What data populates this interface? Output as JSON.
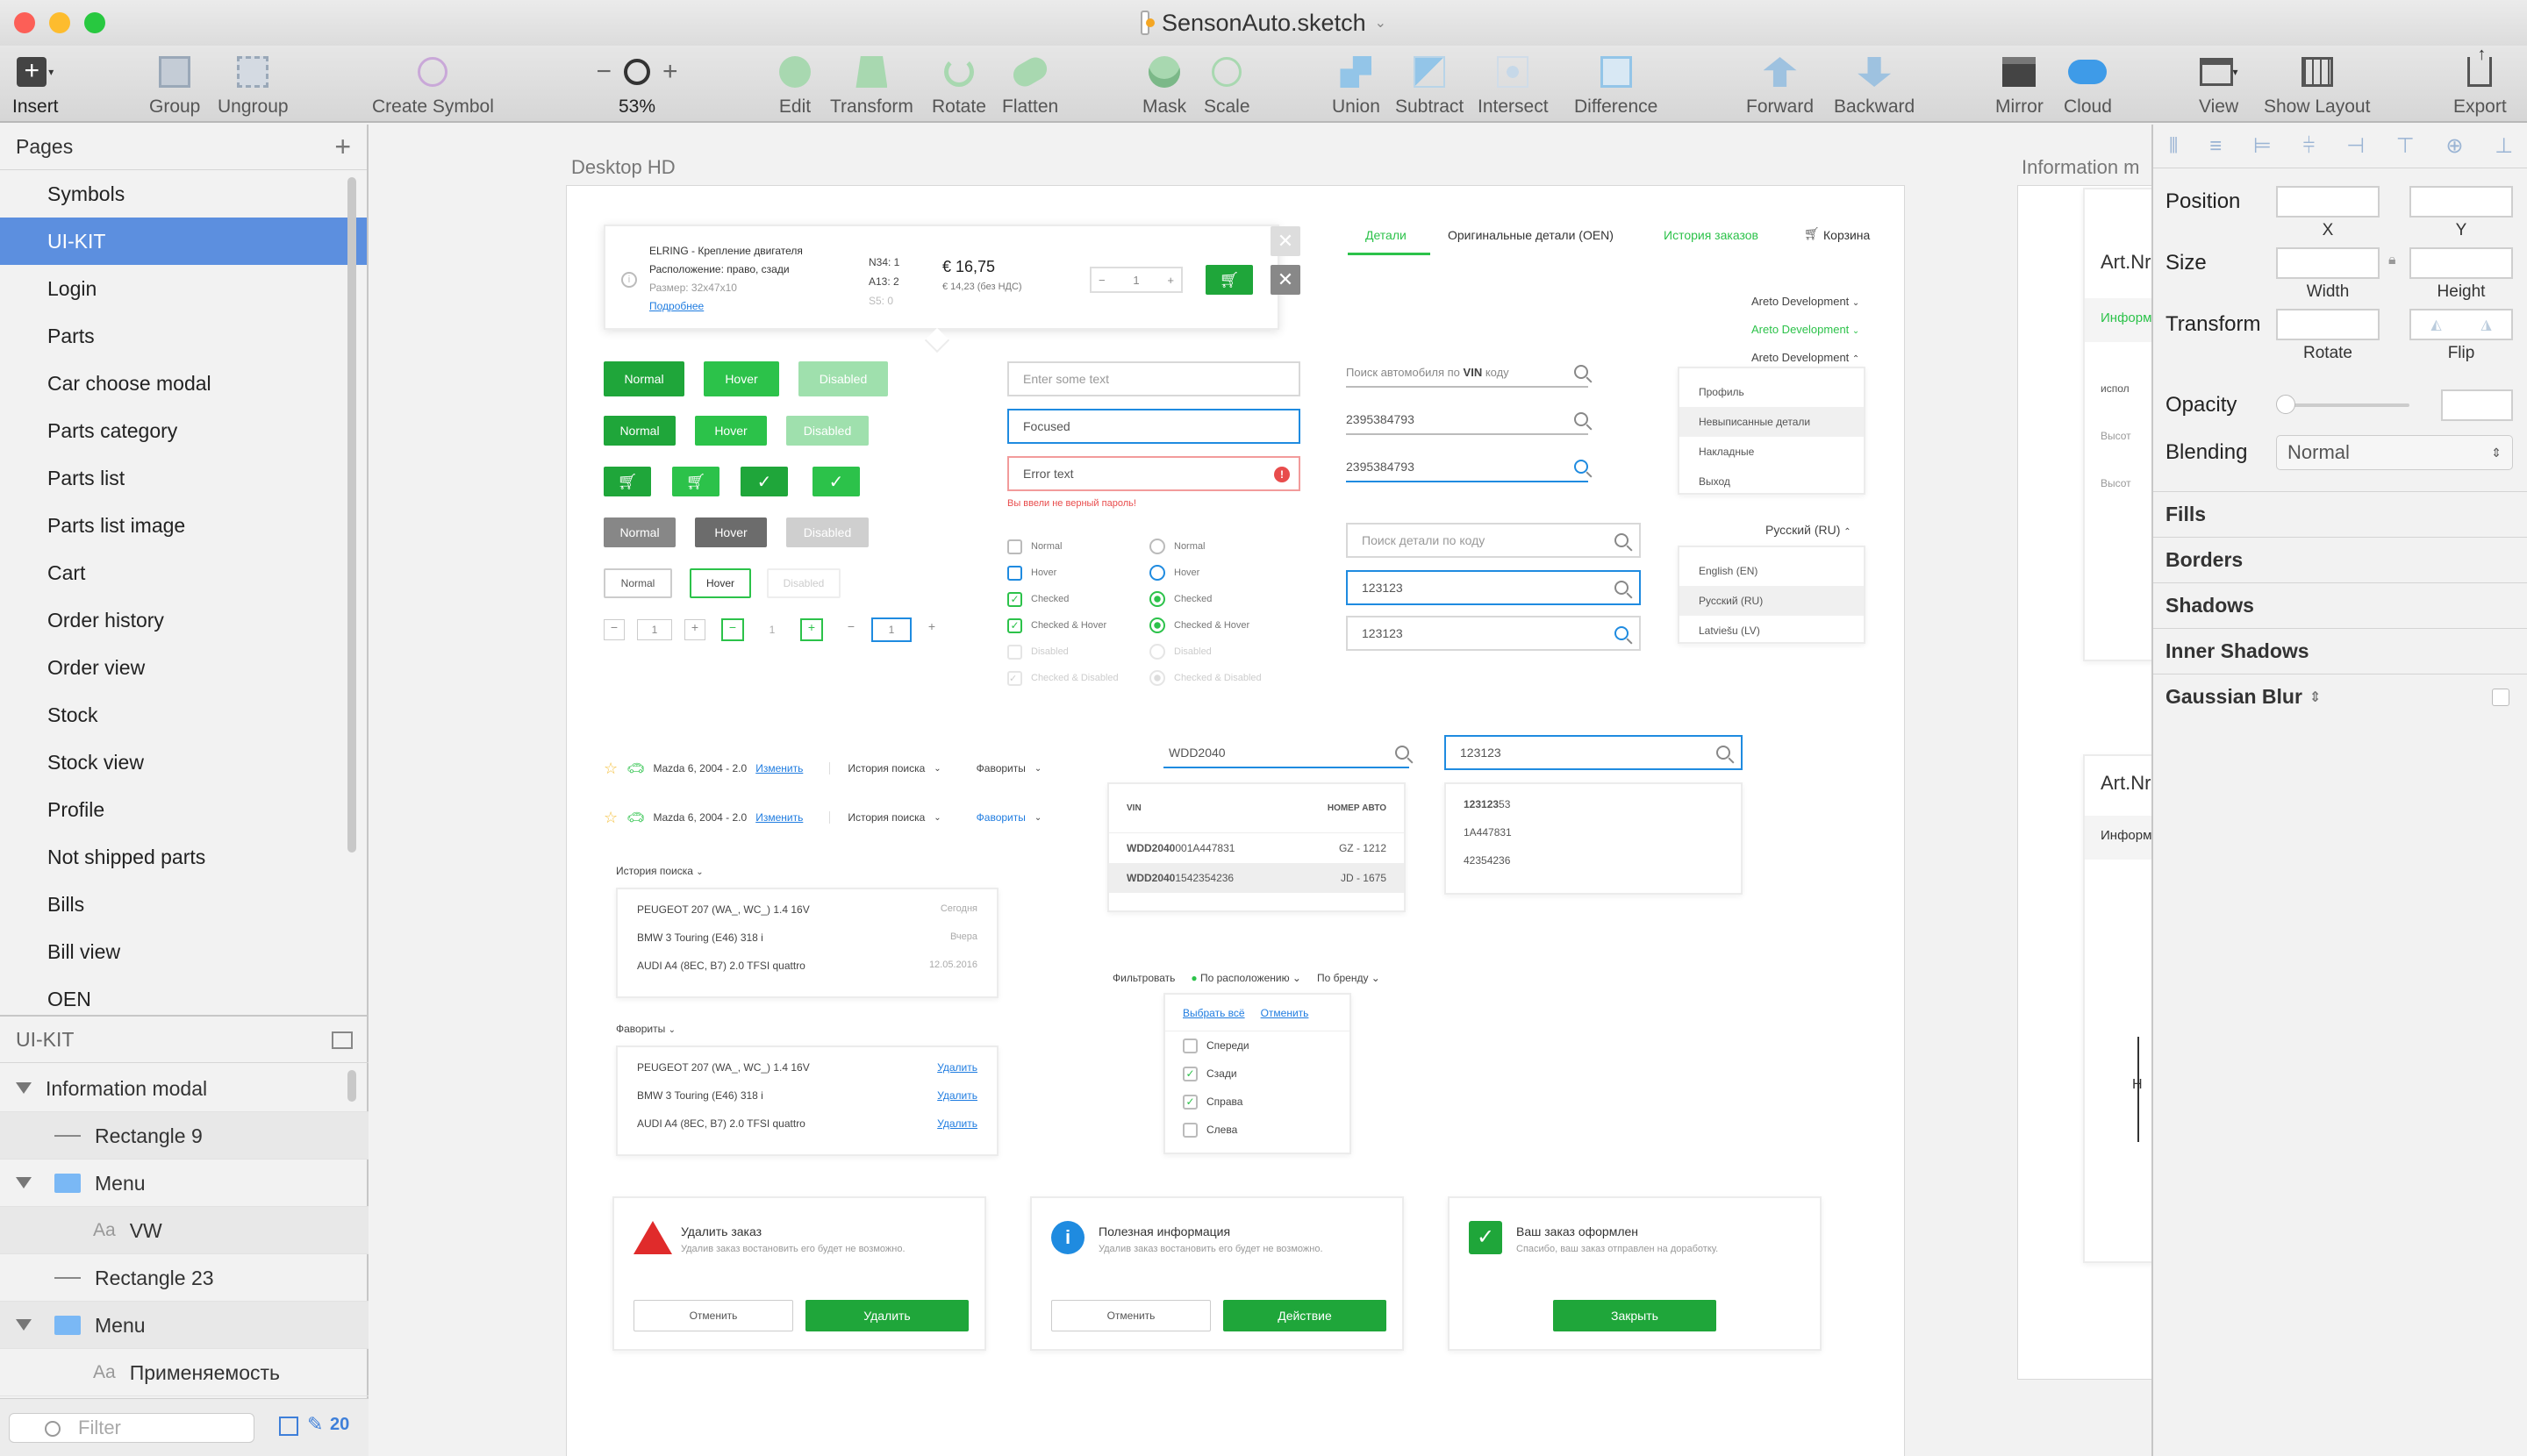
{
  "window": {
    "title": "SensonAuto.sketch"
  },
  "toolbar": {
    "insert": "Insert",
    "group": "Group",
    "ungroup": "Ungroup",
    "create_symbol": "Create Symbol",
    "zoom": "53%",
    "edit": "Edit",
    "transform": "Transform",
    "rotate": "Rotate",
    "flatten": "Flatten",
    "mask": "Mask",
    "scale": "Scale",
    "union": "Union",
    "subtract": "Subtract",
    "intersect": "Intersect",
    "difference": "Difference",
    "forward": "Forward",
    "backward": "Backward",
    "mirror": "Mirror",
    "cloud": "Cloud",
    "view": "View",
    "show_layout": "Show Layout",
    "export": "Export"
  },
  "pages": {
    "header": "Pages",
    "items": [
      "Symbols",
      "UI-KIT",
      "Login",
      "Parts",
      "Car choose modal",
      "Parts category",
      "Parts list",
      "Parts list image",
      "Cart",
      "Order history",
      "Order view",
      "Stock",
      "Stock view",
      "Profile",
      "Not shipped parts",
      "Bills",
      "Bill view",
      "OEN"
    ],
    "selected": "UI-KIT"
  },
  "layers": {
    "header": "UI-KIT",
    "items": [
      {
        "kind": "group-open",
        "label": "Information modal",
        "level": 0
      },
      {
        "kind": "shape",
        "label": "Rectangle 9",
        "level": 1
      },
      {
        "kind": "folder",
        "label": "Menu",
        "level": 1
      },
      {
        "kind": "text",
        "label": "VW",
        "level": 2
      },
      {
        "kind": "shape",
        "label": "Rectangle 23",
        "level": 1
      },
      {
        "kind": "folder",
        "label": "Menu",
        "level": 1
      },
      {
        "kind": "text",
        "label": "Применяемость",
        "level": 2
      }
    ],
    "filter_placeholder": "Filter",
    "count": "20"
  },
  "canvas": {
    "artboard1_label": "Desktop HD",
    "artboard2_label": "Information m",
    "product": {
      "name": "ELRING - Крепление двигателя",
      "location": "Расположение: право, сзади",
      "size": "Размер: 32x47x10",
      "more": "Подробнее",
      "n34": "N34: 1",
      "a13": "A13: 2",
      "s5": "S5: 0",
      "price": "€ 16,75",
      "price_net": "€ 14,23 (без НДС)",
      "qty": "1"
    },
    "tabs": {
      "details": "Детали",
      "oen": "Оригинальные детали (OEN)",
      "history": "История заказов",
      "cart": "Корзина"
    },
    "buttons": {
      "normal": "Normal",
      "hover": "Hover",
      "disabled": "Disabled"
    },
    "steppers": [
      "1",
      "1",
      "1"
    ],
    "inputs": {
      "placeholder": "Enter some text",
      "focused": "Focused",
      "error": "Error text",
      "error_msg": "Вы ввели не верный пароль!"
    },
    "checks": [
      "Normal",
      "Hover",
      "Checked",
      "Checked & Hover",
      "Disabled",
      "Checked & Disabled"
    ],
    "vin_search": {
      "placeholder_pre": "Поиск автомобиля по ",
      "placeholder_bold": "VIN",
      "placeholder_post": " коду",
      "value1": "2395384793",
      "value2": "2395384793"
    },
    "code_search": {
      "placeholder": "Поиск детали по коду",
      "value1": "123123",
      "value2": "123123"
    },
    "account": {
      "name1": "Areto Development",
      "name2": "Areto Development",
      "name3": "Areto Development",
      "menu": [
        "Профиль",
        "Невыписанные детали",
        "Накладные",
        "Выход"
      ]
    },
    "language": {
      "current": "Русский (RU)",
      "menu": [
        "English (EN)",
        "Русский (RU)",
        "Latviešu (LV)"
      ]
    },
    "car_bar": {
      "car": "Mazda 6, 2004 - 2.0",
      "change": "Изменить",
      "history": "История поиска",
      "favorites": "Фавориты"
    },
    "vin_drop": {
      "query": "WDD2040",
      "col1": "VIN",
      "col2": "НОМЕР АВТО",
      "rows": [
        {
          "bold": "WDD2040",
          "rest": "001A447831",
          "plate": "GZ - 1212"
        },
        {
          "bold": "WDD2040",
          "rest": "1542354236",
          "plate": "JD - 1675"
        }
      ]
    },
    "code_drop": {
      "query": "123123",
      "results": [
        {
          "bold": "123123",
          "rest": "53"
        },
        {
          "bold": "",
          "rest": "1A447831"
        },
        {
          "bold": "",
          "rest": "42354236"
        }
      ]
    },
    "history_panel": {
      "title": "История поиска",
      "rows": [
        {
          "car": "PEUGEOT 207 (WA_, WC_) 1.4 16V",
          "when": "Сегодня"
        },
        {
          "car": "BMW 3 Touring (E46) 318 i",
          "when": "Вчера"
        },
        {
          "car": "AUDI A4 (8EC, B7) 2.0 TFSI quattro",
          "when": "12.05.2016"
        }
      ]
    },
    "fav_panel": {
      "title": "Фавориты",
      "rows": [
        {
          "car": "PEUGEOT 207 (WA_, WC_) 1.4 16V",
          "action": "Удалить"
        },
        {
          "car": "BMW 3 Touring (E46) 318 i",
          "action": "Удалить"
        },
        {
          "car": "AUDI A4 (8EC, B7) 2.0 TFSI quattro",
          "action": "Удалить"
        }
      ]
    },
    "filter": {
      "label": "Фильтровать",
      "by_location": "По расположению",
      "by_brand": "По бренду",
      "select_all": "Выбрать всё",
      "cancel": "Отменить",
      "options": [
        {
          "label": "Спереди",
          "checked": false
        },
        {
          "label": "Сзади",
          "checked": true
        },
        {
          "label": "Справа",
          "checked": true
        },
        {
          "label": "Слева",
          "checked": false
        }
      ]
    },
    "modals": [
      {
        "title": "Удалить заказ",
        "text": "Удалив заказ востановить его будет не возможно.",
        "secondary": "Отменить",
        "primary": "Удалить",
        "icon": "warning-icon"
      },
      {
        "title": "Полезная информация",
        "text": "Удалив заказ востановить его будет не возможно.",
        "secondary": "Отменить",
        "primary": "Действие",
        "icon": "info-icon"
      },
      {
        "title": "Ваш заказ оформлен",
        "text": "Спасибо, ваш заказ отправлен на доработку.",
        "primary": "Закрыть",
        "icon": "success-check-icon"
      }
    ],
    "art2": {
      "art1": "Art.Nr:",
      "info1": "Информ",
      "art2": "Art.Nr:",
      "info2": "Информ",
      "r1": "испол",
      "r2": "Высот",
      "r3": "Высот",
      "h": "H"
    }
  },
  "inspector": {
    "position": "Position",
    "x": "X",
    "y": "Y",
    "size": "Size",
    "width": "Width",
    "height": "Height",
    "transform": "Transform",
    "rotate": "Rotate",
    "flip": "Flip",
    "opacity": "Opacity",
    "blending": "Blending",
    "blending_value": "Normal",
    "sections": [
      "Fills",
      "Borders",
      "Shadows",
      "Inner Shadows",
      "Gaussian Blur"
    ]
  },
  "colors": {
    "accent_green": "#2cc24a",
    "selection_blue": "#5c8fdf",
    "error_red": "#e84c4c",
    "link_blue": "#1f7ce0"
  }
}
